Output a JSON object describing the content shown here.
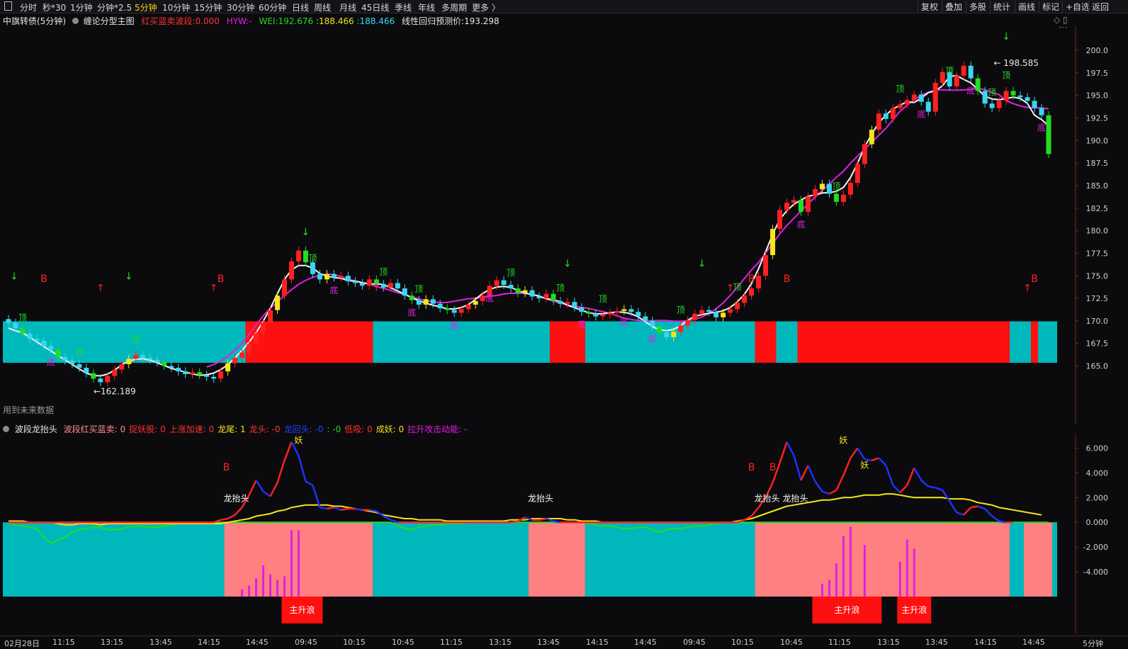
{
  "toolbar": {
    "left": [
      "分时",
      "秒*30",
      "1分钟",
      "分钟*2.5",
      "5分钟",
      "10分钟",
      "15分钟",
      "30分钟",
      "60分钟",
      "日线",
      "周线",
      "月线",
      "45日线",
      "季线",
      "年线",
      "多周期",
      "更多 〉"
    ],
    "active": "5分钟",
    "right": [
      "复权",
      "叠加",
      "多股",
      "统计",
      "画线",
      "标记",
      "+自选",
      "返回"
    ]
  },
  "main_header": {
    "symbol": "中旗转债(5分钟)",
    "indicator": "缠论分型主图",
    "f1_label": "红买蓝卖波段:",
    "f1_value": "0.000",
    "f2_label": "HYW:",
    "f2_value": "-",
    "f3_label": "WEI:",
    "f3_value": "192.676",
    "f4_value": "188.466",
    "f5_value": "188.466",
    "f6_label": "线性回归预测价:",
    "f6_value": "193.298",
    "future_note": "用到未来数据"
  },
  "sub_header": {
    "indicator": "波段龙抬头",
    "items": [
      {
        "label": "波段红买蓝卖:",
        "value": "0",
        "color": "#ff8c8c"
      },
      {
        "label": "捉妖股:",
        "value": "0",
        "color": "#ff3030"
      },
      {
        "label": "上涨加速:",
        "value": "0",
        "color": "#ff3030"
      },
      {
        "label": "龙尾:",
        "value": "1",
        "color": "#f2e21b"
      },
      {
        "label": "龙头:",
        "value": "-0",
        "color": "#ff3030"
      },
      {
        "label": "龙回头:",
        "value": "-0",
        "color": "#2040ff"
      },
      {
        "label": ":",
        "value": "-0",
        "color": "#22dd22"
      },
      {
        "label": "低吸:",
        "value": "0",
        "color": "#ff3030"
      },
      {
        "label": "成妖:",
        "value": "0",
        "color": "#f2e21b"
      },
      {
        "label": "拉升攻击动能:",
        "value": "-",
        "color": "#e020e0"
      }
    ]
  },
  "chart_data": [
    {
      "type": "candlestick",
      "title": "中旗转债(5分钟)",
      "ylim": [
        163.0,
        201.5
      ],
      "yticks": [
        "200.0",
        "197.5",
        "195.0",
        "192.5",
        "190.0",
        "187.5",
        "185.0",
        "182.5",
        "180.0",
        "177.5",
        "175.0",
        "172.5",
        "170.0",
        "167.5",
        "165.0"
      ],
      "annotations": {
        "high": "198.585",
        "low": "162.189",
        "high_arrow": "←162.189"
      },
      "labels": {
        "top": "顶",
        "bottom": "底",
        "buy": "B"
      },
      "close": [
        169.8,
        169.2,
        168.6,
        168.0,
        167.8,
        167.2,
        166.8,
        166.0,
        165.6,
        165.2,
        164.8,
        164.2,
        163.6,
        163.2,
        163.9,
        164.6,
        165.2,
        165.8,
        166.2,
        165.9,
        165.7,
        165.4,
        165.0,
        164.8,
        164.4,
        164.1,
        164.3,
        164.0,
        163.8,
        163.6,
        164.4,
        165.3,
        165.9,
        166.5,
        167.4,
        168.6,
        169.8,
        171.2,
        172.8,
        174.6,
        176.6,
        177.8,
        176.5,
        175.2,
        174.6,
        175.2,
        174.8,
        175.0,
        174.4,
        174.2,
        173.9,
        174.6,
        174.1,
        173.7,
        174.2,
        173.6,
        172.8,
        172.3,
        171.8,
        172.4,
        171.9,
        171.4,
        171.2,
        170.9,
        171.3,
        171.8,
        172.2,
        172.8,
        173.9,
        174.5,
        174.0,
        173.6,
        173.1,
        173.4,
        172.7,
        172.5,
        173.0,
        172.2,
        171.9,
        172.1,
        171.5,
        171.0,
        170.8,
        170.5,
        170.7,
        170.9,
        171.1,
        171.3,
        171.0,
        170.5,
        170.0,
        169.4,
        168.7,
        168.2,
        168.8,
        169.5,
        170.1,
        170.8,
        171.2,
        171.0,
        170.4,
        170.9,
        171.3,
        172.0,
        172.8,
        173.6,
        175.0,
        177.3,
        180.2,
        182.3,
        183.1,
        183.4,
        182.1,
        183.8,
        184.6,
        185.2,
        184.1,
        183.2,
        184.0,
        185.3,
        187.4,
        189.6,
        191.2,
        193.0,
        192.4,
        193.6,
        194.0,
        194.5,
        195.1,
        194.3,
        193.2,
        196.4,
        197.6,
        196.0,
        197.2,
        198.3,
        196.9,
        195.5,
        194.1,
        193.6,
        194.4,
        195.5,
        195.0,
        194.8,
        194.4,
        193.6,
        192.8,
        188.5
      ],
      "volume_note": "candles colored red/green/yellow/cyan"
    },
    {
      "type": "line",
      "title": "波段龙抬头",
      "ylim": [
        -6.0,
        6.6
      ],
      "yticks": [
        "6.000",
        "4.000",
        "2.000",
        "0.000",
        "-2.000",
        "-4.000"
      ],
      "labels": {
        "dragon": "龙抬头",
        "demon": "妖",
        "buy": "B",
        "main_wave": "主升浪"
      },
      "series": [
        {
          "name": "龙头",
          "values": [
            0,
            0,
            0,
            0,
            0,
            0,
            0,
            0,
            0,
            0,
            0,
            0,
            0,
            0,
            0,
            0,
            0,
            0,
            0,
            0,
            0,
            0,
            0,
            0,
            0,
            0,
            0,
            0,
            0,
            0,
            0.2,
            0.3,
            0.6,
            1.2,
            2.2,
            3.4,
            2.5,
            2.1,
            3.2,
            5.0,
            6.5,
            5.4,
            3.3,
            3.0,
            1.2,
            1.1,
            1.2,
            1.0,
            1.1,
            1.1,
            1.0,
            1.0,
            0.9,
            0.5,
            0.2,
            0,
            0,
            0,
            0,
            0,
            0,
            0,
            0,
            0,
            0,
            0,
            0,
            0,
            0,
            0,
            0,
            0,
            0.1,
            0.4,
            0.2,
            0.2,
            0.3,
            0.1,
            0,
            0,
            0,
            0,
            0,
            0,
            0,
            0,
            0,
            0,
            0,
            0,
            0,
            0,
            0,
            0,
            0,
            0,
            0,
            0,
            0,
            0,
            0,
            0,
            0,
            0,
            0.2,
            0.5,
            1.2,
            2.0,
            3.2,
            4.8,
            6.5,
            5.4,
            3.4,
            4.6,
            3.3,
            2.5,
            2.3,
            2.6,
            3.8,
            5.2,
            6.0,
            5.1,
            5.0,
            5.2,
            4.6,
            3.0,
            2.4,
            3.0,
            4.4,
            3.4,
            2.9,
            2.8,
            2.6,
            1.7,
            0.8,
            0.6,
            1.2,
            1.3,
            1.1,
            0.5,
            0.1,
            0.0,
            0.0
          ]
        },
        {
          "name": "龙尾",
          "values": [
            0.1,
            0.1,
            0.1,
            0.0,
            0.0,
            0.0,
            0.0,
            -0.1,
            -0.2,
            -0.2,
            -0.1,
            -0.1,
            -0.1,
            -0.2,
            -0.1,
            -0.1,
            -0.1,
            -0.1,
            -0.1,
            -0.1,
            -0.1,
            -0.1,
            -0.1,
            -0.1,
            -0.1,
            -0.1,
            -0.1,
            -0.1,
            -0.1,
            -0.1,
            -0.1,
            0.0,
            0.1,
            0.2,
            0.3,
            0.5,
            0.6,
            0.7,
            0.9,
            1.0,
            1.2,
            1.3,
            1.4,
            1.4,
            1.4,
            1.4,
            1.3,
            1.3,
            1.2,
            1.1,
            1.0,
            0.9,
            0.8,
            0.6,
            0.5,
            0.4,
            0.3,
            0.3,
            0.2,
            0.2,
            0.2,
            0.2,
            0.1,
            0.1,
            0.1,
            0.1,
            0.1,
            0.1,
            0.1,
            0.1,
            0.1,
            0.2,
            0.2,
            0.2,
            0.3,
            0.3,
            0.3,
            0.3,
            0.3,
            0.2,
            0.2,
            0.1,
            0.1,
            0.1,
            0.0,
            0.0,
            0.0,
            0.0,
            0.0,
            0.0,
            0.0,
            0.0,
            0.0,
            0.0,
            0.0,
            0.0,
            0.0,
            0.0,
            0.0,
            0.0,
            0.0,
            0.0,
            0.0,
            0.1,
            0.2,
            0.3,
            0.5,
            0.7,
            0.9,
            1.1,
            1.3,
            1.4,
            1.5,
            1.6,
            1.7,
            1.8,
            1.8,
            1.9,
            2.0,
            2.0,
            2.1,
            2.2,
            2.2,
            2.2,
            2.3,
            2.3,
            2.2,
            2.1,
            2.0,
            2.0,
            2.0,
            2.0,
            2.0,
            1.9,
            1.9,
            1.9,
            1.8,
            1.6,
            1.5,
            1.4,
            1.2,
            1.1,
            1.0,
            0.9,
            0.8,
            0.7,
            0.6
          ]
        },
        {
          "name": "龙回头",
          "values": [
            -0.1,
            -0.2,
            -0.3,
            -0.4,
            -0.5,
            -1.2,
            -1.7,
            -1.4,
            -1.2,
            -0.8,
            -0.6,
            -0.5,
            -0.4,
            -0.4,
            -0.6,
            -0.6,
            -0.5,
            -0.4,
            -0.3,
            -0.3,
            -0.4,
            -0.4,
            -0.3,
            -0.2,
            -0.1,
            -0.1,
            0,
            0,
            0,
            0,
            0,
            0,
            0,
            0,
            0,
            0,
            0,
            0,
            0,
            0,
            0,
            0,
            0,
            0,
            0,
            0,
            0,
            0,
            0,
            0,
            0,
            0,
            0,
            0,
            0,
            -0.3,
            -0.5,
            -0.6,
            -0.4,
            -0.3,
            -0.2,
            -0.2,
            -0.1,
            -0.1,
            -0.1,
            0,
            0,
            0,
            0,
            0,
            0,
            0,
            0,
            0,
            0,
            0,
            0,
            0,
            0,
            0,
            0,
            0,
            -0.1,
            -0.2,
            -0.3,
            -0.3,
            -0.4,
            -0.5,
            -0.5,
            -0.4,
            -0.4,
            -0.6,
            -0.8,
            -0.6,
            -0.5,
            -0.5,
            -0.4,
            -0.3,
            -0.3,
            -0.2,
            -0.1,
            0,
            0,
            0,
            0,
            0,
            0,
            0,
            0,
            0,
            0,
            0,
            0,
            0,
            0,
            0,
            0,
            0,
            0,
            0,
            0,
            0,
            0,
            0,
            0,
            0,
            0,
            0,
            0,
            0,
            0,
            0,
            0,
            0,
            0,
            0,
            0,
            0,
            0,
            0,
            0,
            0,
            0,
            0,
            0,
            0,
            0,
            0
          ]
        }
      ]
    }
  ],
  "time_axis": [
    "02月28日",
    "11:15",
    "13:15",
    "13:45",
    "14:15",
    "14:45",
    "09:45",
    "10:15",
    "10:45",
    "11:15",
    "13:15",
    "13:45",
    "14:15",
    "14:45",
    "09:45",
    "10:15",
    "10:45",
    "11:15",
    "13:15",
    "13:45",
    "14:15",
    "14:45"
  ],
  "period_label": "5分钟",
  "colors": {
    "up": "#ff2020",
    "down": "#00c8c8",
    "yellow": "#f5e61a",
    "green": "#22dd22",
    "cyan": "#3ad6f0",
    "band_red": "#ff1010",
    "band_cyan": "#00b8bb",
    "band_pink": "#ff8080",
    "ma_white": "#f4f4f4",
    "ma_magenta": "#e020e0",
    "axis": "#c8c8c8"
  }
}
